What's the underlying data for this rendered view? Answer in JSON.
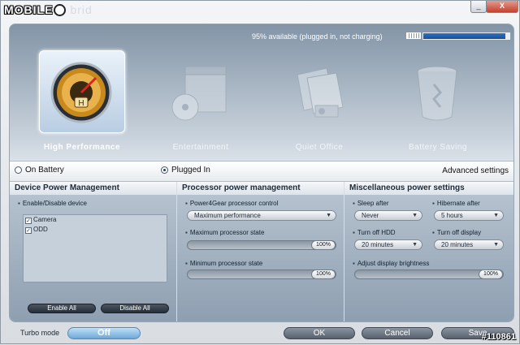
{
  "brand": {
    "prefix": "MOBILE",
    "tail": "brid"
  },
  "window_controls": {
    "minimize": "_",
    "close": "X"
  },
  "battery": {
    "status_text": "95% available (plugged in, not charging)",
    "level_percent": 95
  },
  "modes": [
    {
      "label": "High Performance",
      "icon": "speedometer-icon",
      "active": true
    },
    {
      "label": "Entertainment",
      "icon": "clapperboard-disc-icon",
      "active": false
    },
    {
      "label": "Quiet Office",
      "icon": "projector-papers-icon",
      "active": false
    },
    {
      "label": "Battery Saving",
      "icon": "recycle-bin-icon",
      "active": false
    }
  ],
  "power_source": {
    "on_battery": "On Battery",
    "plugged_in": "Plugged In",
    "selected": "Plugged In"
  },
  "advanced_settings": "Advanced settings",
  "device_power": {
    "title": "Device Power Management",
    "enable_label": "Enable/Disable device",
    "devices": [
      {
        "name": "Camera",
        "checked": true
      },
      {
        "name": "ODD",
        "checked": true
      }
    ],
    "enable_all": "Enable All",
    "disable_all": "Disable All"
  },
  "processor": {
    "title": "Processor power management",
    "control_label": "Power4Gear processor control",
    "control_value": "Maximum performance",
    "max_label": "Maximum processor state",
    "max_value": "100%",
    "min_label": "Minimum processor state",
    "min_value": "100%"
  },
  "misc": {
    "title": "Miscellaneous power settings",
    "sleep_label": "Sleep after",
    "sleep_value": "Never",
    "hibernate_label": "Hibernate after",
    "hibernate_value": "5 hours",
    "hdd_label": "Turn off HDD",
    "hdd_value": "20 minutes",
    "display_label": "Turn off display",
    "display_value": "20 minutes",
    "brightness_label": "Adjust display brightness",
    "brightness_value": "100%"
  },
  "footer": {
    "turbo_label": "Turbo mode",
    "turbo_value": "Off",
    "ok": "OK",
    "cancel": "Cancel",
    "save": "Save"
  },
  "watermark": "#110861"
}
